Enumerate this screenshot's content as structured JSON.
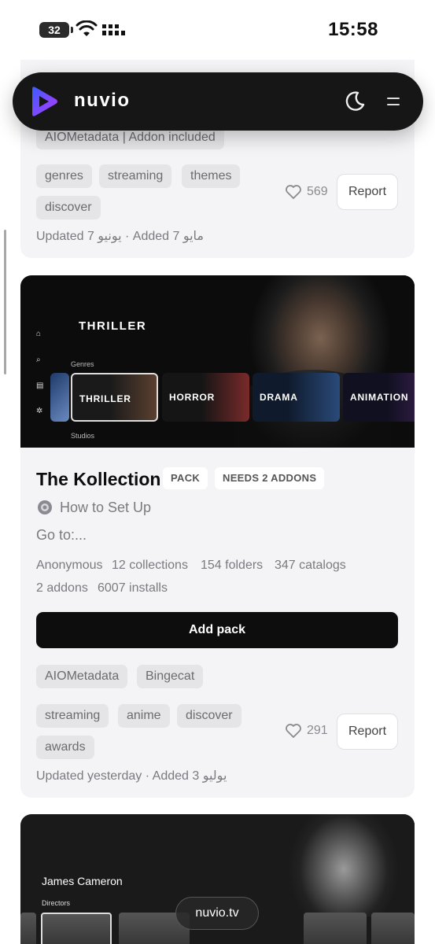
{
  "status_bar": {
    "battery": "32",
    "time": "15:58"
  },
  "navbar": {
    "brand": "nuvio",
    "icons": [
      "moon-icon",
      "menu-icon"
    ]
  },
  "card1": {
    "chip_partial": "AIOMetadata | Addon included",
    "tags": [
      "genres",
      "streaming",
      "themes",
      "discover"
    ],
    "likes": "569",
    "report_label": "Report",
    "updated": "Updated 7 يونيو · Added 7 مايو"
  },
  "card2": {
    "banner": {
      "title": "THRILLER",
      "genres_label": "Genres",
      "studios_label": "Studios",
      "genres": [
        "THRILLER",
        "HORROR",
        "DRAMA",
        "ANIMATION"
      ]
    },
    "title": "The Kollection",
    "badges": [
      "PACK",
      "NEEDS 2 ADDONS"
    ],
    "setup_label": "How to Set Up",
    "goto": "Go to:...",
    "meta": [
      "Anonymous",
      "12 collections",
      "154 folders",
      "347 catalogs",
      "2 addons",
      "6007 installs"
    ],
    "add_pack_label": "Add pack",
    "addons": [
      "AIOMetadata",
      "Bingecat"
    ],
    "tags": [
      "streaming",
      "anime",
      "discover",
      "awards"
    ],
    "likes": "291",
    "report_label": "Report",
    "updated": "Updated yesterday · Added 3 يوليو"
  },
  "card3": {
    "title": "James Cameron",
    "sub_label": "Directors"
  },
  "url_pill": "nuvio.tv",
  "colors": {
    "accent_logo_start": "#3b5bff",
    "accent_logo_end": "#a03bff",
    "button_dark": "#0d0d0d"
  }
}
